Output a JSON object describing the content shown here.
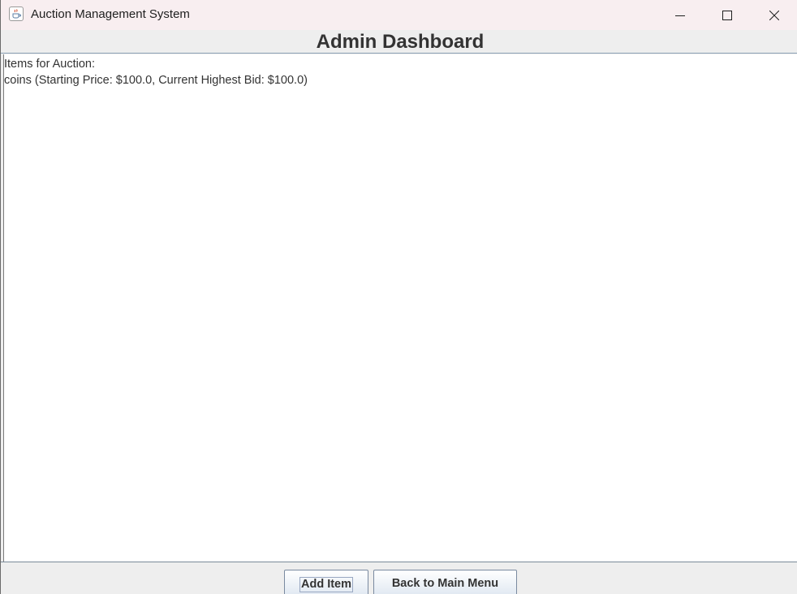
{
  "window": {
    "title": "Auction Management System",
    "app_icon": "java-cup-icon",
    "controls": [
      "minimize-icon",
      "maximize-icon",
      "close-icon"
    ]
  },
  "header": {
    "title": "Admin Dashboard"
  },
  "content": {
    "lines": [
      "Items for Auction:",
      "coins (Starting Price: $100.0, Current Highest Bid: $100.0)"
    ]
  },
  "buttons": {
    "add_item": "Add Item",
    "back_to_main_menu": "Back to Main Menu"
  },
  "colors": {
    "titlebar_bg": "#f8eef0",
    "panel_bg": "#eeeeee",
    "text": "#333333",
    "button_border": "#7a8aa0"
  }
}
